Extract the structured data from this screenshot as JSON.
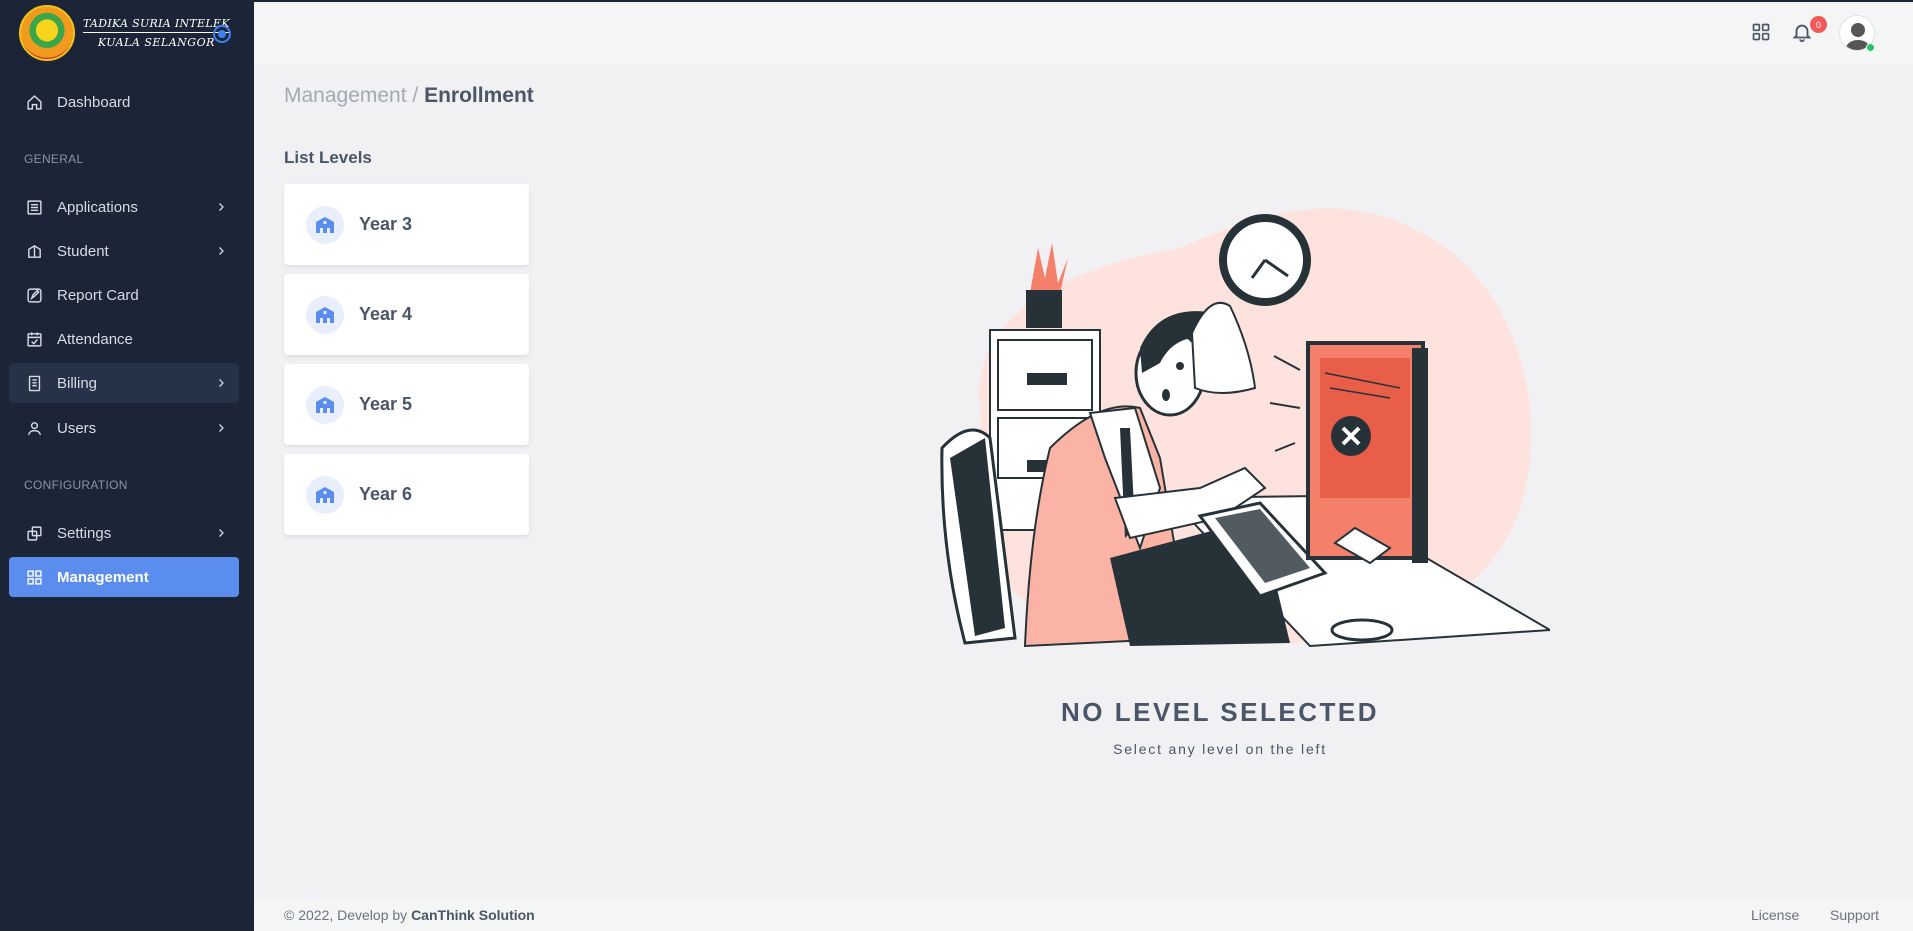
{
  "brand": {
    "line1": "TADIKA SURIA INTELEK",
    "line2": "KUALA SELANGOR"
  },
  "sidebar": {
    "items": [
      {
        "label": "Dashboard",
        "icon": "home-icon"
      },
      {
        "label": "Applications",
        "icon": "list-icon"
      },
      {
        "label": "Student",
        "icon": "book-icon"
      },
      {
        "label": "Report Card",
        "icon": "edit-icon"
      },
      {
        "label": "Attendance",
        "icon": "calendar-check-icon"
      },
      {
        "label": "Billing",
        "icon": "receipt-icon"
      },
      {
        "label": "Users",
        "icon": "user-icon"
      },
      {
        "label": "Settings",
        "icon": "settings-icon"
      },
      {
        "label": "Management",
        "icon": "grid-icon"
      }
    ],
    "sections": {
      "general": "GENERAL",
      "configuration": "CONFIGURATION"
    }
  },
  "header": {
    "notification_count": "0"
  },
  "breadcrumb": {
    "parent": "Management / ",
    "current": "Enrollment"
  },
  "levels": {
    "title": "List Levels",
    "items": [
      "Year 3",
      "Year 4",
      "Year 5",
      "Year 6"
    ]
  },
  "empty_state": {
    "title": "NO LEVEL SELECTED",
    "subtitle": "Select any level on the left"
  },
  "footer": {
    "copyright": "© 2022, Develop by ",
    "company": "CanThink Solution",
    "license": "License",
    "support": "Support"
  },
  "colors": {
    "sidebar": "#1b2537",
    "accent": "#5b8def",
    "text": "#4b5568",
    "illustration": "#f4806c"
  }
}
